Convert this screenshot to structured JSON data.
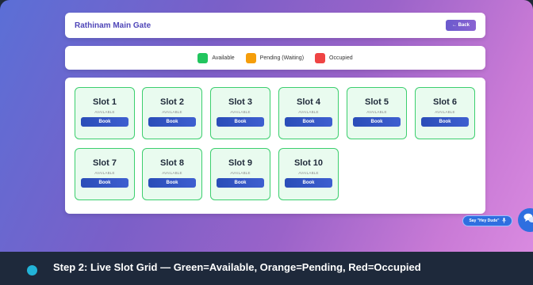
{
  "header": {
    "title": "Rathinam Main Gate",
    "back_label": "← Back"
  },
  "legend": [
    {
      "label": "Available",
      "color": "#22c55e"
    },
    {
      "label": "Pending (Waiting)",
      "color": "#f59e0b"
    },
    {
      "label": "Occupied",
      "color": "#ef4444"
    }
  ],
  "slots": [
    {
      "name": "Slot 1",
      "status": "AVAILABLE",
      "action": "Book"
    },
    {
      "name": "Slot 2",
      "status": "AVAILABLE",
      "action": "Book"
    },
    {
      "name": "Slot 3",
      "status": "AVAILABLE",
      "action": "Book"
    },
    {
      "name": "Slot 4",
      "status": "AVAILABLE",
      "action": "Book"
    },
    {
      "name": "Slot 5",
      "status": "AVAILABLE",
      "action": "Book"
    },
    {
      "name": "Slot 6",
      "status": "AVAILABLE",
      "action": "Book"
    },
    {
      "name": "Slot 7",
      "status": "AVAILABLE",
      "action": "Book"
    },
    {
      "name": "Slot 8",
      "status": "AVAILABLE",
      "action": "Book"
    },
    {
      "name": "Slot 9",
      "status": "AVAILABLE",
      "action": "Book"
    },
    {
      "name": "Slot 10",
      "status": "AVAILABLE",
      "action": "Book"
    }
  ],
  "voice": {
    "label": "Say \"Hey Dude\"",
    "icon": "microphone-icon"
  },
  "chat": {
    "icon": "chat-bubbles-icon"
  },
  "caption": {
    "text": "Step 2: Live Slot Grid — Green=Available, Orange=Pending, Red=Occupied"
  }
}
